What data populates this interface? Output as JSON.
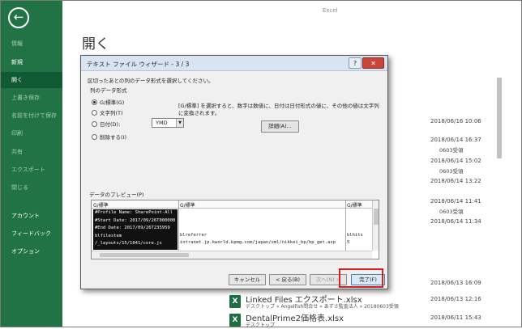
{
  "app": {
    "title": "Excel"
  },
  "sidebar": {
    "back_icon": "←",
    "items": [
      {
        "label": "情報",
        "dim": true
      },
      {
        "label": "新規",
        "dim": false
      },
      {
        "label": "開く",
        "dim": false,
        "active": true
      },
      {
        "label": "上書き保存",
        "dim": true
      },
      {
        "label": "名前を付けて保存",
        "dim": true
      },
      {
        "label": "印刷",
        "dim": true
      },
      {
        "label": "共有",
        "dim": true
      },
      {
        "label": "エクスポート",
        "dim": true
      },
      {
        "label": "閉じる",
        "dim": true
      },
      {
        "label": "アカウント",
        "dim": false
      },
      {
        "label": "フィードバック",
        "dim": false
      },
      {
        "label": "オプション",
        "dim": false
      }
    ]
  },
  "main": {
    "heading": "開く",
    "background_dates": [
      "2018/06/16 10:06",
      "2018/06/14 16:37",
      "2018/06/14 15:02",
      "2018/06/14 13:22",
      "2018/06/14 11:41",
      "2018/06/14 11:34",
      "2018/06/13 16:09"
    ],
    "folder_snippets": [
      "0603受領",
      "0603受領",
      "0603受領"
    ],
    "recent_files": [
      {
        "name": "Linked Files エクスポート.xlsx",
        "path": "デスクトップ » Angelfish問合せ » あずさ監査法人 » 20180603受領",
        "date": "2018/06/13 12:16"
      },
      {
        "name": "DentalPrime2価格表.xlsx",
        "path": "デスクトップ",
        "date": "2018/06/11 15:43"
      }
    ]
  },
  "dialog": {
    "title": "テキスト ファイル ウィザード - 3 / 3",
    "help_label": "?",
    "close_label": "✕",
    "description": "区切ったあとの列のデータ形式を選択してください。",
    "format_group_label": "列のデータ形式",
    "radios": [
      {
        "label": "G/標準(G)",
        "checked": true
      },
      {
        "label": "文字列(T)",
        "checked": false
      },
      {
        "label": "日付(D):",
        "checked": false
      },
      {
        "label": "削除する(I)",
        "checked": false
      }
    ],
    "date_format": "YMD",
    "info_text": "[G/標準] を選択すると、数字は数値に、日付は日付形式の値に、その他の値は文字列に変換されます。",
    "advanced_button": "詳細(A)...",
    "preview_label": "データのプレビュー(P)",
    "preview": {
      "headers": [
        "G/標準",
        "G/標準",
        "G/標準"
      ],
      "col1": [
        "#Profile Name: SharePoint-All",
        "#Start Date: 2017/09/26T000000",
        "#End Date: 2017/09/26T235959",
        "blfilestem",
        "/_layouts/15/1041/core.js"
      ],
      "col2_row4": "blreferrer",
      "col2_row5": "intranet.jp.kworld.kpmg.com/japan/xml/nikkei_bp/bp_get.asp",
      "col3_row4": "blhits",
      "col3_row5": "5"
    },
    "buttons": {
      "cancel": "キャンセル",
      "back": "< 戻る(B)",
      "next": "次へ(N) >",
      "finish": "完了(F)"
    }
  }
}
